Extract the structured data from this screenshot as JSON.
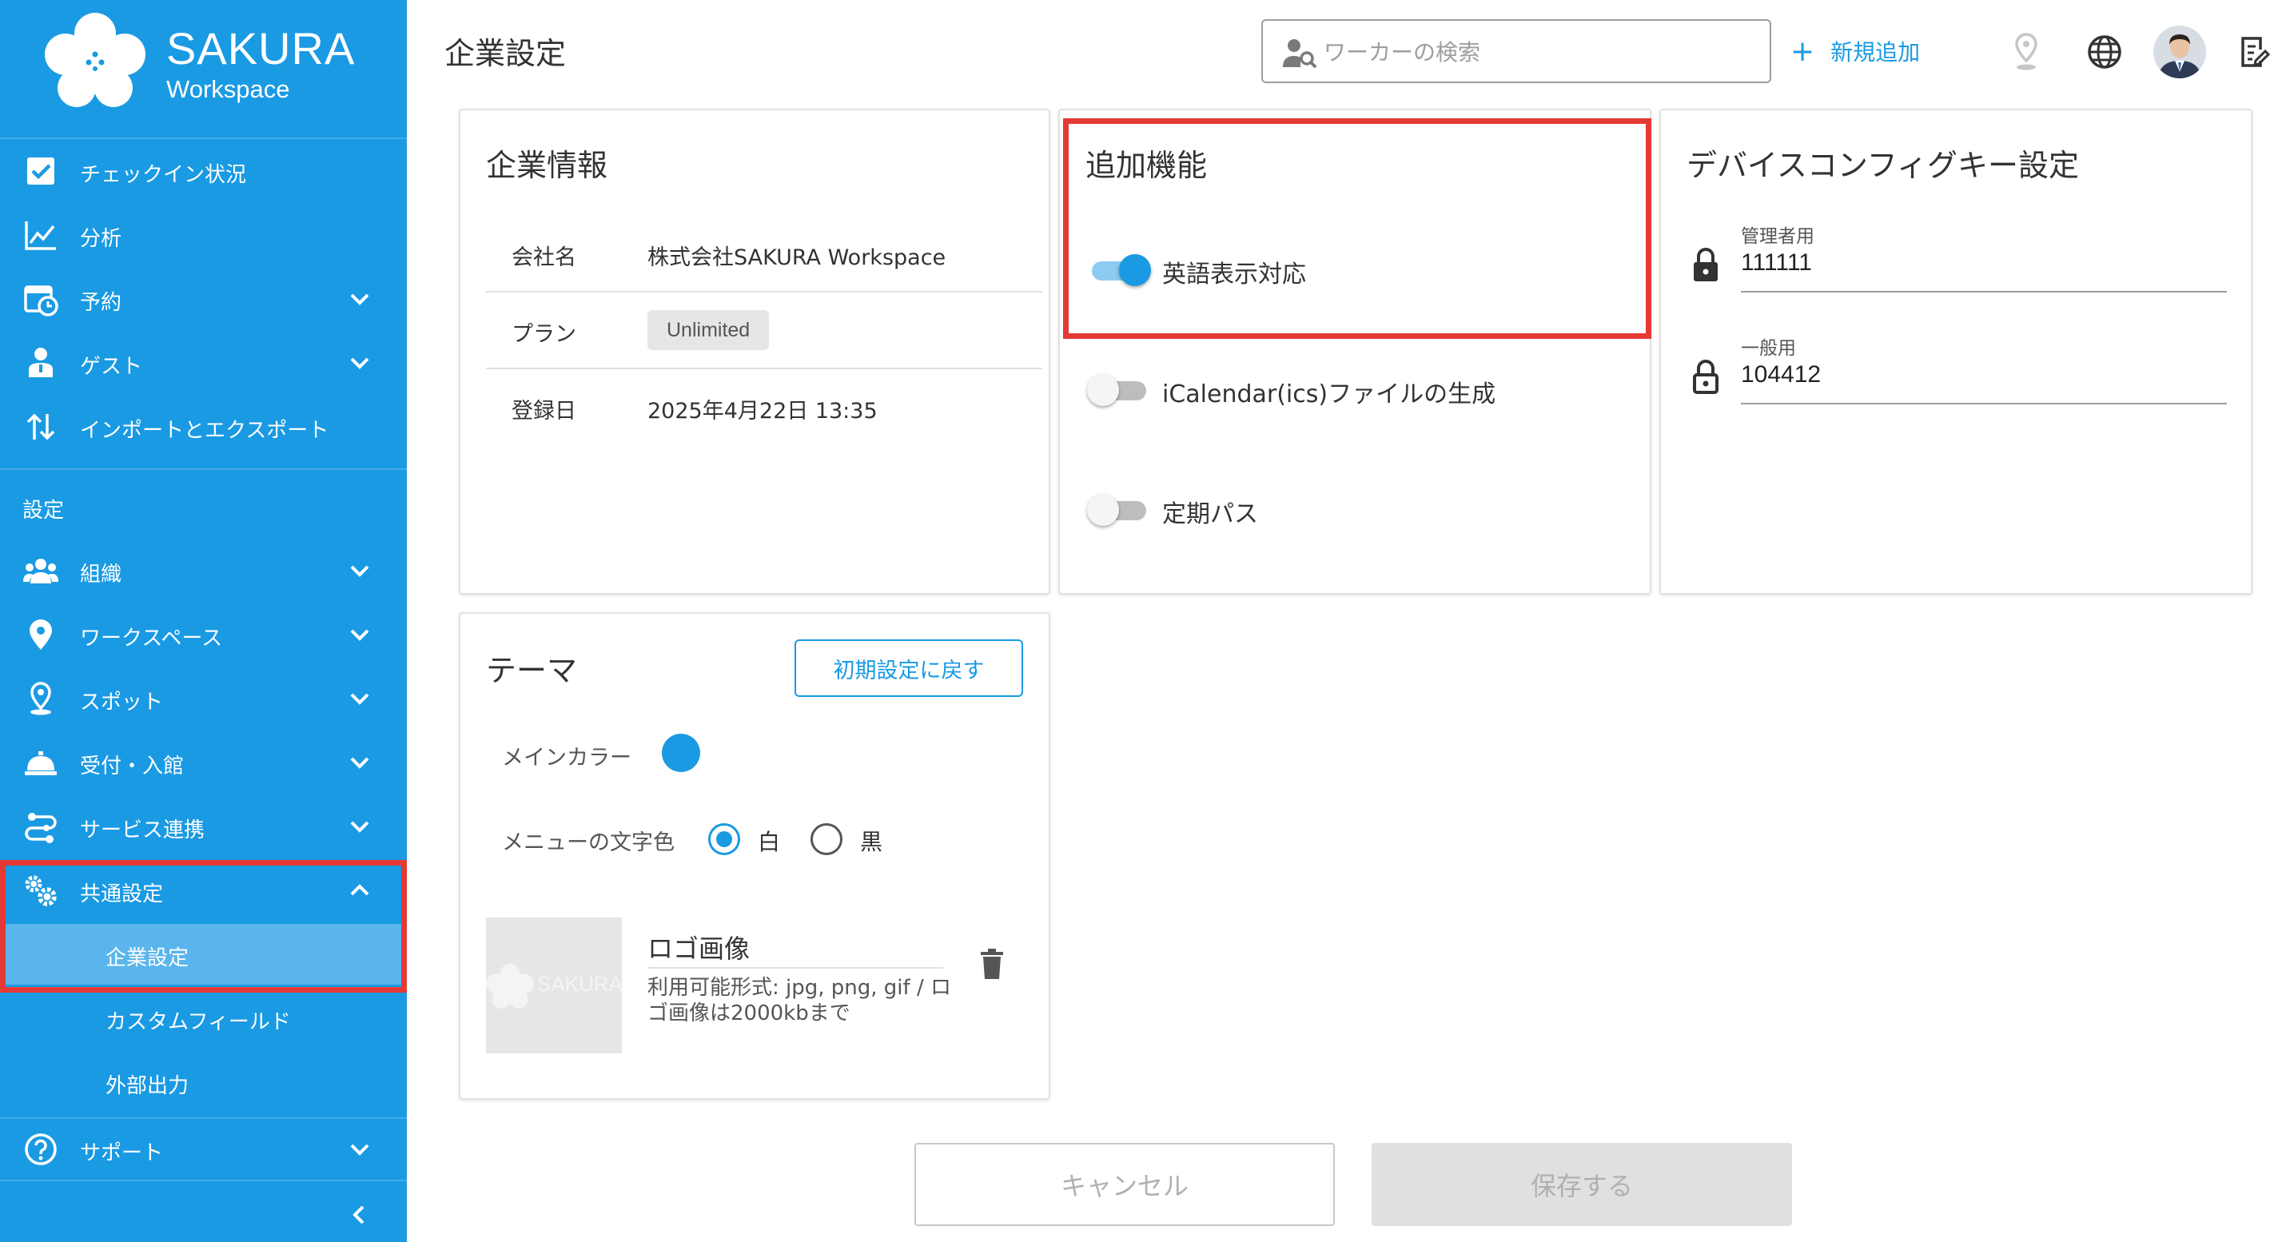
{
  "brand": {
    "name": "SAKURA",
    "subtitle": "Workspace"
  },
  "sidebar": {
    "items": [
      {
        "label": "チェックイン状況",
        "icon": "checkbox-icon"
      },
      {
        "label": "分析",
        "icon": "chart-line-icon"
      },
      {
        "label": "予約",
        "icon": "calendar-clock-icon"
      },
      {
        "label": "ゲスト",
        "icon": "guest-icon"
      },
      {
        "label": "インポートとエクスポート",
        "icon": "import-export-icon"
      }
    ],
    "settings_section": "設定",
    "settings_items": [
      {
        "label": "組織",
        "icon": "people-icon"
      },
      {
        "label": "ワークスペース",
        "icon": "location-pin-icon"
      },
      {
        "label": "スポット",
        "icon": "spot-pin-icon"
      },
      {
        "label": "受付・入館",
        "icon": "reception-bell-icon"
      },
      {
        "label": "サービス連携",
        "icon": "integration-icon"
      },
      {
        "label": "共通設定",
        "icon": "gears-icon"
      }
    ],
    "common_sub": [
      {
        "label": "企業設定"
      },
      {
        "label": "カスタムフィールド"
      },
      {
        "label": "外部出力"
      }
    ],
    "support": {
      "label": "サポート",
      "icon": "help-circle-icon"
    }
  },
  "header": {
    "title": "企業設定",
    "search_placeholder": "ワーカーの検索",
    "add_label": "新規追加"
  },
  "company_info": {
    "title": "企業情報",
    "rows": [
      {
        "key": "会社名",
        "value": "株式会社SAKURA Workspace"
      },
      {
        "key": "プラン",
        "value": "Unlimited"
      },
      {
        "key": "登録日",
        "value": "2025年4月22日 13:35"
      }
    ]
  },
  "features": {
    "title": "追加機能",
    "toggles": [
      {
        "label": "英語表示対応",
        "on": true
      },
      {
        "label": "iCalendar(ics)ファイルの生成",
        "on": false
      },
      {
        "label": "定期パス",
        "on": false
      }
    ]
  },
  "device_keys": {
    "title": "デバイスコンフィグキー設定",
    "admin_label": "管理者用",
    "admin_value": "111111",
    "general_label": "一般用",
    "general_value": "104412"
  },
  "theme": {
    "title": "テーマ",
    "reset_label": "初期設定に戻す",
    "main_color_label": "メインカラー",
    "main_color": "#1a9ae3",
    "menu_text_label": "メニューの文字色",
    "option_white": "白",
    "option_black": "黒",
    "selected": "white",
    "logo_title": "ロゴ画像",
    "logo_desc": "利用可能形式: jpg, png, gif / ロゴ画像は2000kbまで",
    "logo_thumb_text": "SAKURA"
  },
  "footer": {
    "cancel_label": "キャンセル",
    "save_label": "保存する"
  },
  "colors": {
    "brand": "#1a9ae3",
    "highlight": "#e53935",
    "active_sub": "#5ab5ec"
  }
}
